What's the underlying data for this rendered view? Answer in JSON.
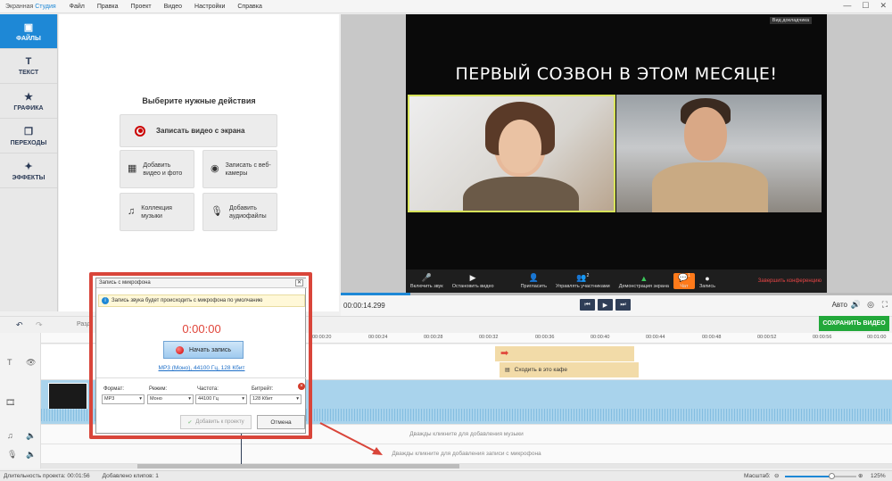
{
  "app": {
    "name_part1": "Экранная",
    "name_part2": "Студия"
  },
  "menu": [
    "Файл",
    "Правка",
    "Проект",
    "Видео",
    "Настройки",
    "Справка"
  ],
  "window_controls": [
    "—",
    "☐",
    "✕"
  ],
  "tabs": [
    {
      "label": "ФАЙЛЫ",
      "icon": "file-icon",
      "active": true
    },
    {
      "label": "ТЕКСТ",
      "icon": "text-icon"
    },
    {
      "label": "ГРАФИКА",
      "icon": "star-icon"
    },
    {
      "label": "ПЕРЕХОДЫ",
      "icon": "transitions-icon"
    },
    {
      "label": "ЭФФЕКТЫ",
      "icon": "wand-icon"
    }
  ],
  "actions": {
    "title": "Выберите нужные действия",
    "record_screen": "Записать видео с экрана",
    "add_video": "Добавить видео и фото",
    "webcam": "Записать с веб-камеры",
    "music": "Коллекция музыки",
    "audio": "Добавить аудиофайлы"
  },
  "video": {
    "title": "ПЕРВЫЙ СОЗВОН В ЭТОМ МЕСЯЦЕ!",
    "speaker_view": "Вид докладчика",
    "toolbar": {
      "mute": "Включить звук",
      "stop_video": "Остановить видео",
      "invite": "Пригласить",
      "manage": "Управлять участниками",
      "participants_count": "2",
      "share": "Демонстрация экрана",
      "chat": "Чат",
      "chat_badge": "1",
      "record": "Запись",
      "end": "Завершить конференцию"
    }
  },
  "playback": {
    "time": "00:00:14.299",
    "auto": "Авто",
    "progress_pct": 12.6
  },
  "save_button": "СОХРАНИТЬ ВИДЕО",
  "split_label": "Разд",
  "ruler": [
    "00:00:20",
    "00:00:24",
    "00:00:28",
    "00:00:32",
    "00:00:36",
    "00:00:40",
    "00:00:44",
    "00:00:48",
    "00:00:52",
    "00:00:56",
    "00:01:00"
  ],
  "timeline": {
    "cafe_clip": "Сходить в это кафе",
    "music_hint": "Дважды кликните для добавления музыки",
    "mic_hint": "Дважды кликните для добавления записи с микрофона"
  },
  "status": {
    "duration_label": "Длительность проекта:",
    "duration": "00:01:56",
    "clips_label": "Добавлено клипов:",
    "clips": "1",
    "zoom_label": "Масштаб:",
    "zoom": "125%",
    "zoom_level": 0.65
  },
  "dialog": {
    "title": "Запись с микрофона",
    "info": "Запись звука будет происходить с микрофона по умолчанию",
    "time": "0:00:00",
    "start": "Начать запись",
    "link": "MP3 (Моно), 44100 Гц, 128 Кбит",
    "format_label": "Формат:",
    "format": "MP3",
    "mode_label": "Режим:",
    "mode": "Моно",
    "freq_label": "Частота:",
    "freq": "44100 Гц",
    "bitrate_label": "Битрейт:",
    "bitrate": "128 Кбит",
    "add": "Добавить к проекту",
    "cancel": "Отмена"
  }
}
